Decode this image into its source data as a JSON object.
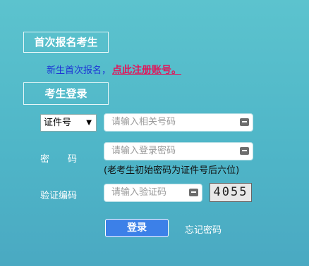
{
  "new_candidate": {
    "title": "首次报名考生",
    "text": "新生首次报名，",
    "register_link": "点此注册账号。"
  },
  "login": {
    "title": "考生登录",
    "id_type": {
      "selected": "证件号"
    },
    "id_placeholder": "请输入相关号码",
    "password_label": "密　　码",
    "password_placeholder": "请输入登录密码",
    "password_hint": "(老考生初始密码为证件号后六位)",
    "captcha_label": "验证编码",
    "captcha_placeholder": "请输入验证码",
    "captcha_text": "4055",
    "login_button": "登录",
    "forgot_link": "忘记密码"
  }
}
